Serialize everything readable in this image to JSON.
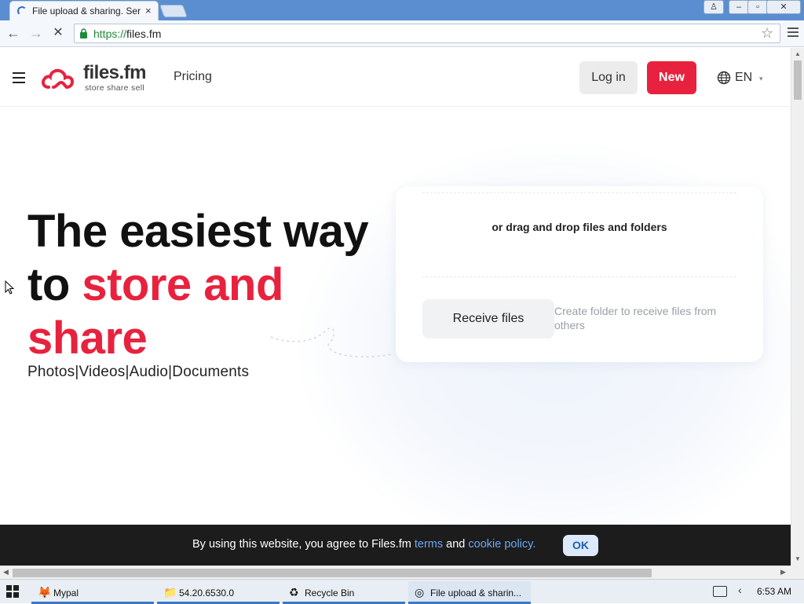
{
  "browser": {
    "tab_title": "File upload & sharing. Ser",
    "tab_close": "×",
    "window_buttons": {
      "user": "♙",
      "minimize": "–",
      "maximize": "▫",
      "close": "✕"
    },
    "back_icon": "←",
    "forward_icon": "→",
    "reload_icon": "✕",
    "url_scheme": "https://",
    "url_host": "files.fm",
    "star_icon": "☆"
  },
  "header": {
    "logo_name": "files.fm",
    "logo_tagline": "store share sell",
    "pricing_label": "Pricing",
    "login_label": "Log in",
    "new_label": "New",
    "language_code": "EN",
    "language_caret": "▾"
  },
  "hero": {
    "title_line1": "The easiest way",
    "title_line2_plain": "to ",
    "title_line2_red": "store and",
    "title_line3_red": "share",
    "media_types": "Photos|Videos|Audio|Documents"
  },
  "upload_card": {
    "drop_text": "or drag and drop files and folders",
    "receive_label": "Receive files",
    "receive_hint": "Create folder to receive files from others"
  },
  "cookie_bar": {
    "text_before": "By using this website, you agree to Files.fm ",
    "terms_link": "terms",
    "text_middle": " and ",
    "cookie_link": "cookie policy.",
    "ok_label": "OK"
  },
  "scrollbars": {
    "up": "▲",
    "down": "▼",
    "left": "◀",
    "right": "▶"
  },
  "taskbar": {
    "items": [
      {
        "label": "Mypal",
        "icon": "🦊"
      },
      {
        "label": "54.20.6530.0",
        "icon": "📁"
      },
      {
        "label": "Recycle Bin",
        "icon": "♻"
      },
      {
        "label": "File upload & sharin...",
        "icon": "◎"
      }
    ],
    "tray_arrow": "‹",
    "clock": "6:53 AM"
  },
  "colors": {
    "brand_red": "#e8223e",
    "link_blue": "#6ea7f0",
    "titlebar_blue": "#5a8ed0"
  }
}
